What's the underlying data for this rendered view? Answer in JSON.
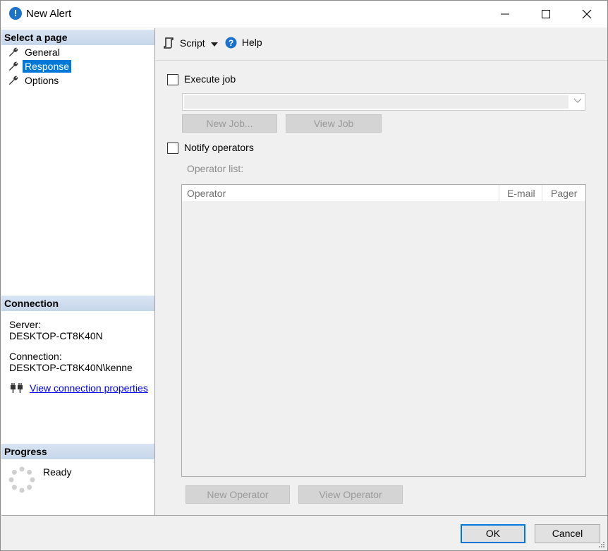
{
  "window": {
    "title": "New Alert",
    "icon": "alert-info-icon"
  },
  "left_panel": {
    "select_page_header": "Select a page",
    "pages": [
      {
        "label": "General",
        "icon": "wrench-icon",
        "selected": false
      },
      {
        "label": "Response",
        "icon": "wrench-icon",
        "selected": true
      },
      {
        "label": "Options",
        "icon": "wrench-icon",
        "selected": false
      }
    ],
    "connection_header": "Connection",
    "server_label": "Server:",
    "server_value": "DESKTOP-CT8K40N",
    "connection_label": "Connection:",
    "connection_value": "DESKTOP-CT8K40N\\kenne",
    "connection_link": "View connection properties",
    "progress_header": "Progress",
    "progress_status": "Ready"
  },
  "toolbar": {
    "script_label": "Script",
    "help_label": "Help"
  },
  "response": {
    "execute_job_label": "Execute job",
    "execute_job_checked": false,
    "job_combo_value": "",
    "new_job_button": "New Job...",
    "view_job_button": "View Job",
    "notify_operators_label": "Notify operators",
    "notify_operators_checked": false,
    "operator_list_label": "Operator list:",
    "grid_columns": [
      "Operator",
      "E-mail",
      "Pager"
    ],
    "new_operator_button": "New Operator",
    "view_operator_button": "View Operator"
  },
  "footer": {
    "ok_label": "OK",
    "cancel_label": "Cancel"
  },
  "colors": {
    "selection": "#0078d7",
    "link": "#0000ee",
    "header_gradient": "#c6d6ea"
  }
}
